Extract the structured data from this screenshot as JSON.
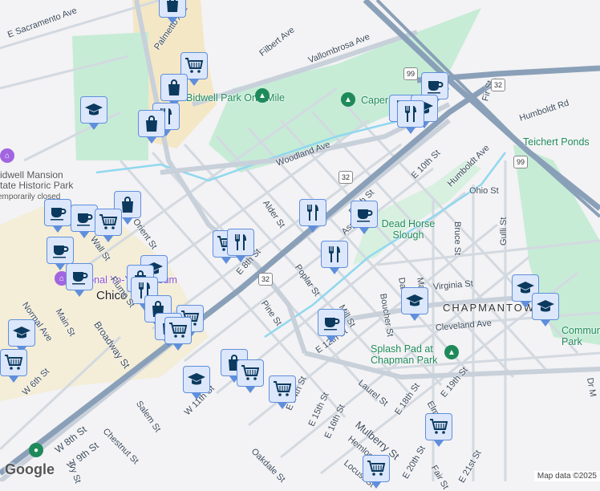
{
  "map": {
    "attribution": "Map data ©2025",
    "logo": "Google",
    "colors": {
      "park": "#c6ecd6",
      "road": "#c8d0da",
      "highway": "#8aa0b8",
      "creek": "#8fd8ef",
      "campus": "#f4e7c5",
      "marker_fill": "#dce7fb",
      "marker_border": "#5f8fdc",
      "icon": "#0b3a5e"
    },
    "streets": [
      "E Sacramento Ave",
      "Palmetto Ave",
      "Filbert Ave",
      "Vallombrosa Ave",
      "Woodland Ave",
      "Alder St",
      "E 8th St",
      "E 9th St",
      "Aspen St",
      "E 10th St",
      "Humboldt Ave",
      "Ohio St",
      "Bruce St",
      "Gulli St",
      "Humboldt Rd",
      "Fir St",
      "Poplar St",
      "Pine St",
      "Mill St",
      "Boucher St",
      "Davis St",
      "Mar St",
      "Virginia St",
      "Cleveland Ave",
      "E 12th St",
      "Laurel St",
      "E 18th St",
      "Elm St",
      "E 19th St",
      "Mulberry St",
      "E 14th St",
      "E 15th St",
      "E 16th St",
      "Hemlock St",
      "Locust St",
      "E 20th St",
      "Fair St",
      "E 21st St",
      "W 8th St",
      "W 9th St",
      "Chestnut St",
      "Ivy St",
      "Oakdale St",
      "Salem St",
      "W 11th St",
      "Normal Ave",
      "Broadway St",
      "W 6th St",
      "Wall St",
      "Main St",
      "Flume St",
      "Orient St",
      "Dr M"
    ],
    "street_list_extra": [
      "Ash St"
    ],
    "highways": [
      "99",
      "32"
    ],
    "places": {
      "bidwell_park": "Bidwell Park One-Mile",
      "caper": "Caper Acres",
      "teichert": "Teichert Ponds",
      "dead_horse": "Dead Horse Slough",
      "splash": "Splash Pad at Chapman Park",
      "community": "Community Park",
      "mansion": "Bidwell Mansion State Historic Park",
      "mansion_status": "Temporarily closed",
      "museum": "National Yo-Yo Museum",
      "city": "Chico",
      "hood": "CHAPMANTOWN"
    },
    "markers": [
      "shopping",
      "cafe",
      "school",
      "restaurant",
      "grocery"
    ]
  }
}
